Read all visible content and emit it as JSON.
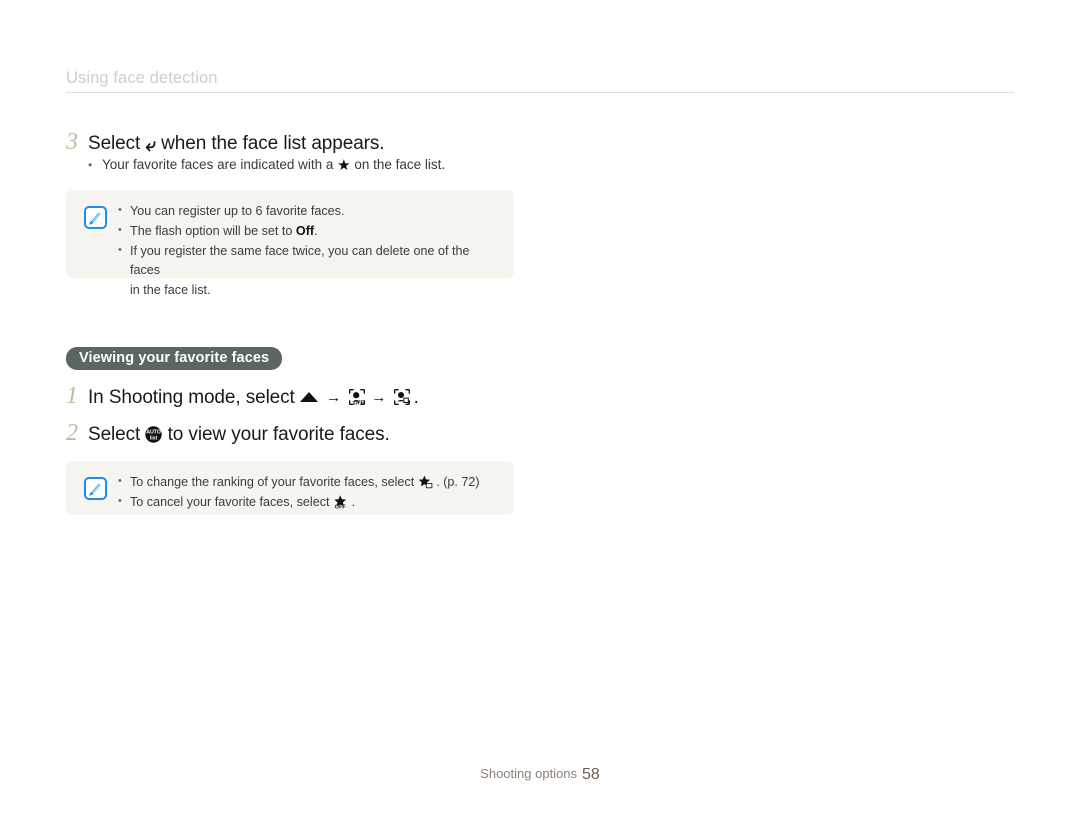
{
  "page": {
    "background": "#ffffff",
    "running_head": "Using face detection",
    "running_head_color": "#c9d2c9"
  },
  "step3": {
    "number": "3",
    "text_before_icon": "Select",
    "icon": "back-arrow-icon",
    "text_after_icon": "when the face list appears.",
    "bullet": {
      "dot": "•",
      "text_before_icon": "Your favorite faces are indicated with a",
      "icon": "star-icon",
      "text_after_icon": "on the face list."
    }
  },
  "note1": {
    "icon": "note-pen-icon",
    "items": [
      {
        "dot": "•",
        "text": "You can register up to 6 favorite faces."
      },
      {
        "dot": "•",
        "text_before_bold": "The flash option will be set to ",
        "bold": "Off",
        "text_after_bold": "."
      },
      {
        "dot": "•",
        "text": "If you register the same face twice, you can delete one of the faces",
        "continuation": "in the face list."
      }
    ]
  },
  "section": {
    "pill_label": "Viewing your favorite faces",
    "pill_bg": "#5b6660",
    "pill_color": "#ffffff"
  },
  "step1": {
    "number": "1",
    "text_before": "In Shooting mode, select",
    "icon_1": "up-triangle-icon",
    "arrow_1": "→",
    "icon_2": "smart-face-recognition-off-icon",
    "arrow_2": "→",
    "icon_3": "smart-face-recognition-icon",
    "text_after": "."
  },
  "step2": {
    "number": "2",
    "text_before": "Select",
    "icon": "auto-face-list-icon",
    "text_after": "to view your favorite faces."
  },
  "note2": {
    "icon": "note-pen-icon",
    "items": [
      {
        "dot": "•",
        "text_before_icon": "To change the ranking of your favorite faces, select",
        "icon": "star-rank-icon",
        "text_after_icon": ". (p. 72)"
      },
      {
        "dot": "•",
        "text_before_icon": "To cancel your favorite faces, select",
        "icon": "star-off-icon",
        "text_after_icon": "."
      }
    ]
  },
  "footer": {
    "label": "Shooting options",
    "page_number": "58"
  }
}
